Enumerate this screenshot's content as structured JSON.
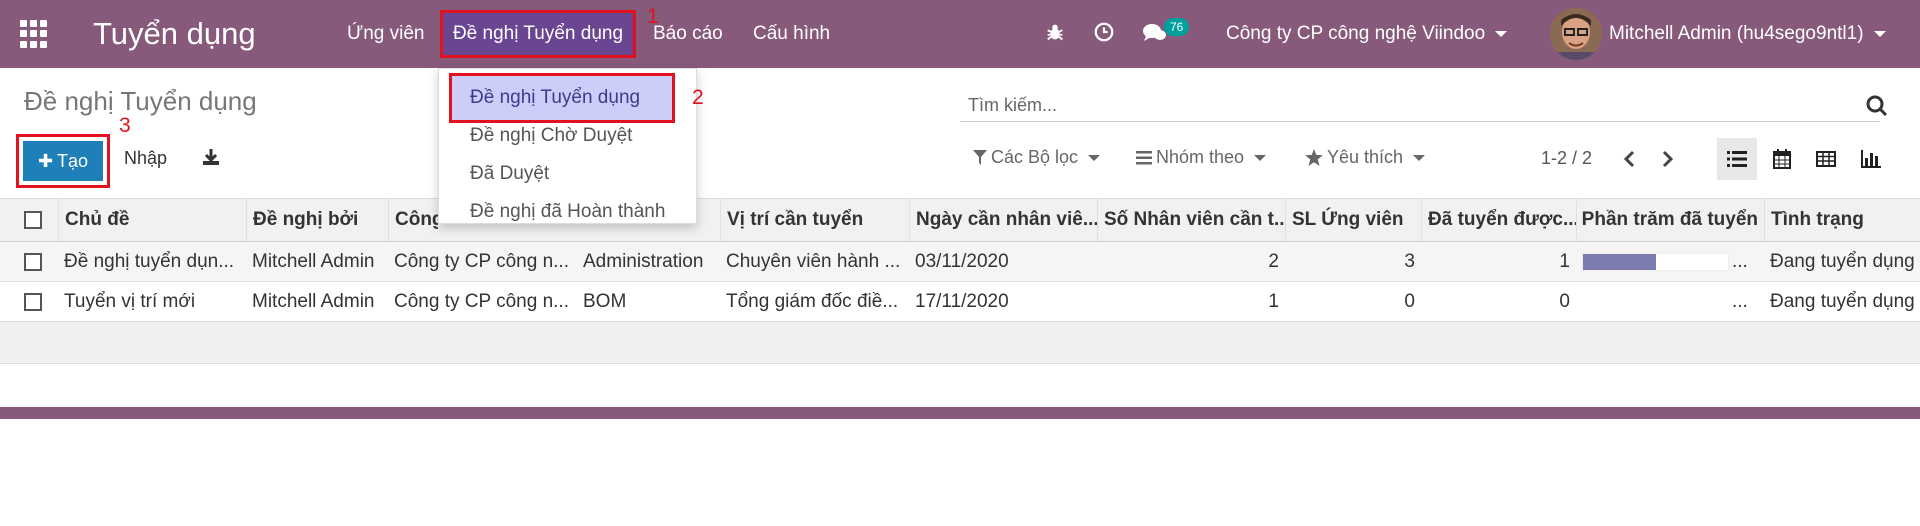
{
  "navbar": {
    "app_title": "Tuyển dụng",
    "menu": [
      "Ứng viên",
      "Đề nghị Tuyển dụng",
      "Báo cáo",
      "Cấu hình"
    ],
    "chat_count": "76",
    "company": "Công ty CP công nghệ Viindoo",
    "user": "Mitchell Admin (hu4sego9ntl1)"
  },
  "annotations": [
    "1",
    "2",
    "3"
  ],
  "dropdown": {
    "items": [
      "Đề nghị Tuyển dụng",
      "Đề nghị Chờ Duyệt",
      "Đã Duyệt",
      "Đề nghị đã Hoàn thành"
    ]
  },
  "control": {
    "page_title": "Đề nghị Tuyển dụng",
    "create_label": "Tạo",
    "import_label": "Nhập",
    "search_placeholder": "Tìm kiếm...",
    "filters": "Các Bộ lọc",
    "group_by": "Nhóm theo",
    "favorites": "Yêu thích",
    "pager": "1-2 / 2"
  },
  "table": {
    "columns": [
      "Chủ đề",
      "Đề nghị bởi",
      "Công",
      "",
      "Vị trí cần tuyển",
      "Ngày cần nhân viê...",
      "Số Nhân viên cần t...",
      "SL Ứng viên",
      "Đã tuyển được...",
      "Phần trăm đã tuyển",
      "Tình trạng"
    ],
    "rows": [
      {
        "subject": "Đề nghị tuyển dụn...",
        "requested_by": "Mitchell Admin",
        "company": "Công ty CP công n...",
        "department": "Administration",
        "position": "Chuyên viên hành ...",
        "date": "03/11/2020",
        "needed": "2",
        "applicants": "3",
        "hired": "1",
        "percent": 0.5,
        "ellipsis": "...",
        "status": "Đang tuyển dụng"
      },
      {
        "subject": "Tuyển vị trí mới",
        "requested_by": "Mitchell Admin",
        "company": "Công ty CP công n...",
        "department": "BOM",
        "position": "Tổng giám đốc điề...",
        "date": "17/11/2020",
        "needed": "1",
        "applicants": "0",
        "hired": "0",
        "percent": 0,
        "ellipsis": "...",
        "status": "Đang tuyển dụng"
      }
    ]
  },
  "colors": {
    "navbar": "#875a7b",
    "primary": "#1f7fb8",
    "annotation": "#e0121d",
    "progress": "#7c7bad"
  }
}
